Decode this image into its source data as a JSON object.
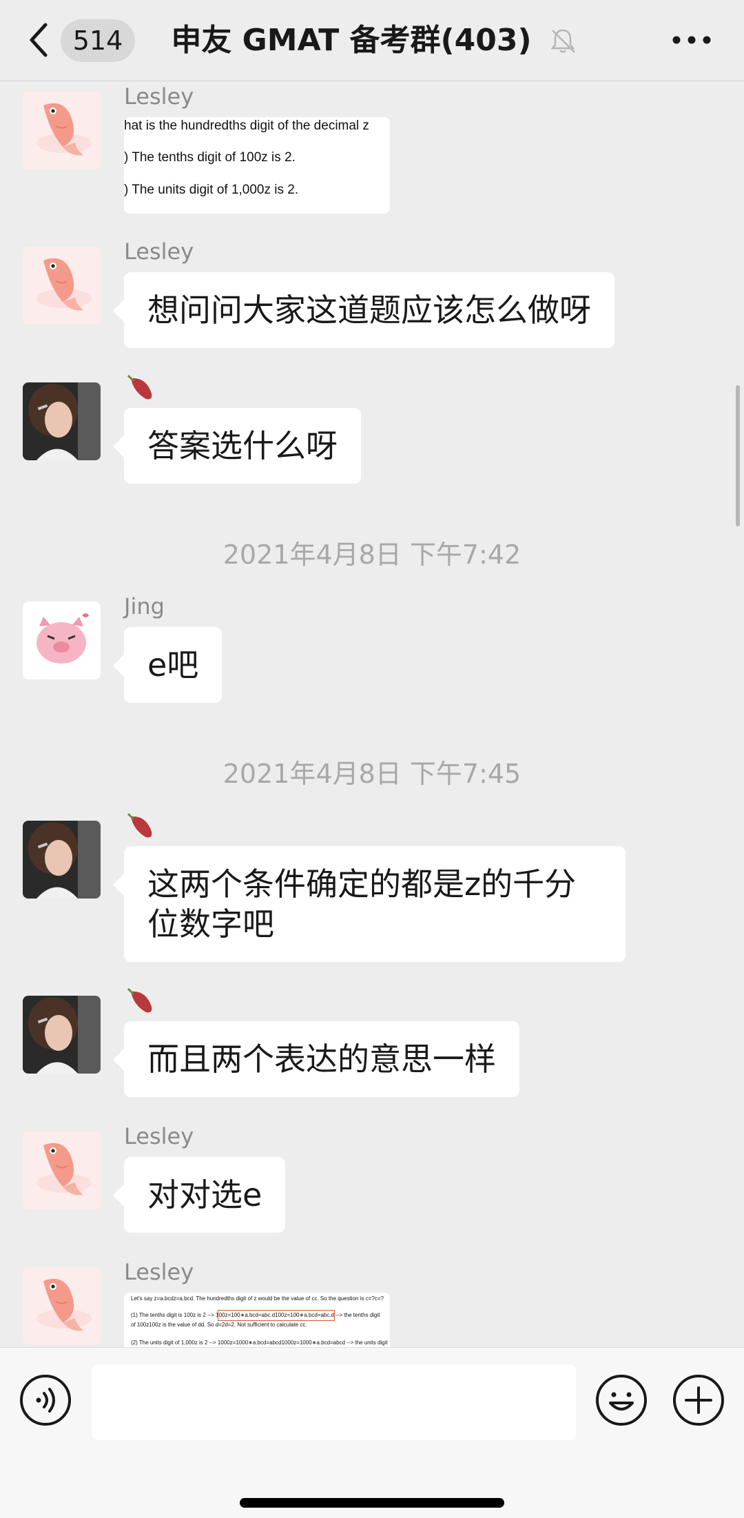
{
  "header": {
    "back_count": "514",
    "title": "申友 GMAT 备考群(403)"
  },
  "messages": [
    {
      "sender": "Lesley",
      "type": "image",
      "image_lines": [
        "hat is the hundredths digit of the decimal z",
        ")    The tenths digit of 100z is 2.",
        ")    The units digit of 1,000z is 2."
      ]
    },
    {
      "sender": "Lesley",
      "type": "text",
      "text": "想问问大家这道题应该怎么做呀"
    },
    {
      "sender": "",
      "type": "text",
      "text": "答案选什么呀"
    },
    {
      "type": "timestamp",
      "text": "2021年4月8日 下午7:42"
    },
    {
      "sender": "Jing",
      "type": "text",
      "text": "e吧"
    },
    {
      "type": "timestamp",
      "text": "2021年4月8日 下午7:45"
    },
    {
      "sender": "",
      "type": "text",
      "text_line1": "这两个条件确定的都是z的千分",
      "text_line2": "位数字吧"
    },
    {
      "sender": "",
      "type": "text",
      "text": "而且两个表达的意思一样"
    },
    {
      "sender": "Lesley",
      "type": "text",
      "text": "对对选e"
    },
    {
      "sender": "Lesley",
      "type": "image",
      "image_lines": [
        "Let's say z=a.bcdz=a.bcd. The hundredths digit of z would be the value of cc. So the question is c=?c=?",
        "(1) The tenths digit is 100z is 2 --> 100z=100∗a.bcd=abc.d100z=100∗a.bcd=abc.d --> the tenths digit",
        "of 100z100z is the value of dd. So d=2d=2. Not sufficient to calculate cc.",
        "(2) The units digit of 1,000z is 2 --> 1000z=1000∗a.bcd=abcd1000z=1000∗a.bcd=abcd --> the units digit"
      ]
    }
  ],
  "colors": {
    "background": "#ededed",
    "bubble": "#ffffff",
    "highlight_box": "#e0542a"
  },
  "icons": [
    "chevron-left-icon",
    "bell-off-icon",
    "more-dots-icon",
    "sweet-potato-icon",
    "voice-icon",
    "emoji-icon",
    "plus-icon"
  ]
}
